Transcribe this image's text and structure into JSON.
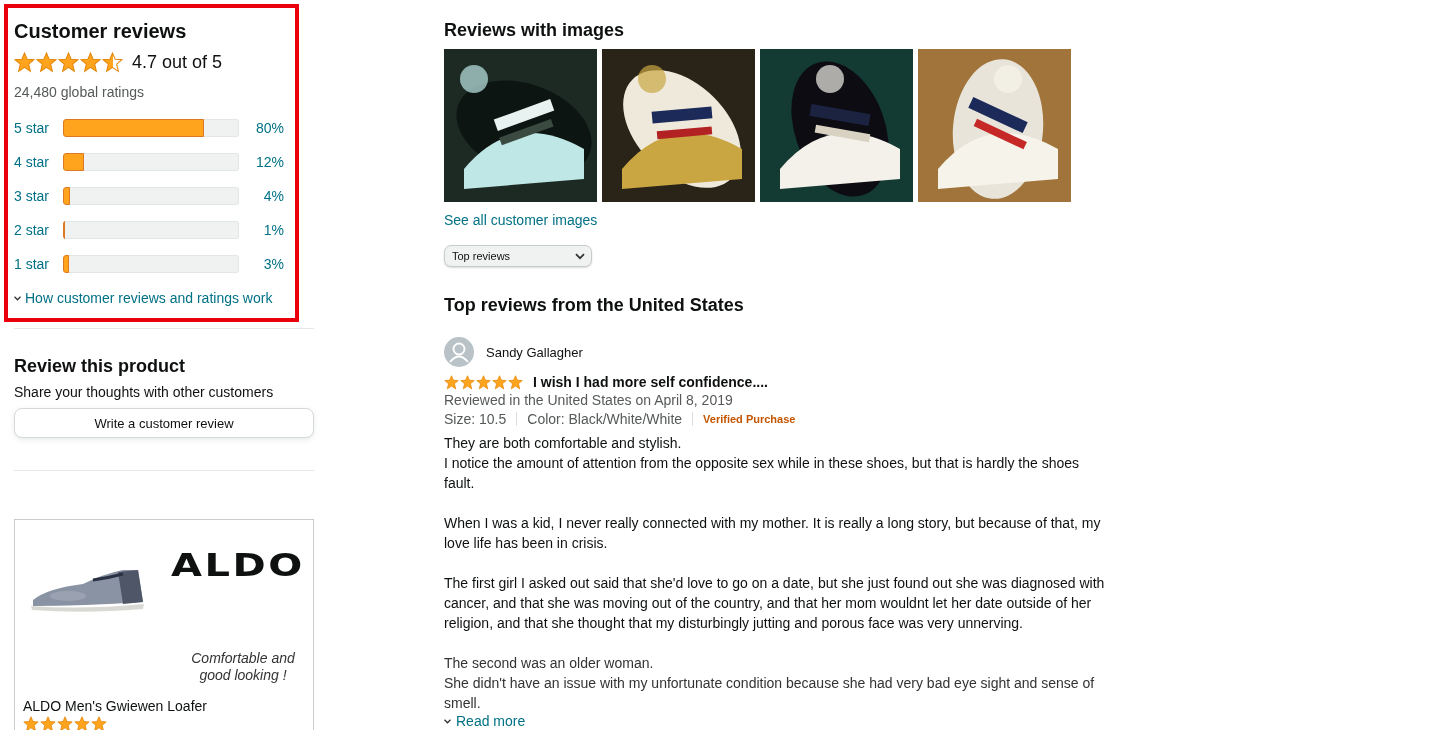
{
  "ratings": {
    "title": "Customer reviews",
    "stars": 4.5,
    "average": "4.7 out of 5",
    "total": "24,480 global ratings",
    "histogram": [
      {
        "label": "5 star",
        "level": 0.8,
        "percent": "80%"
      },
      {
        "label": "4 star",
        "level": 0.12,
        "percent": "12%"
      },
      {
        "label": "3 star",
        "level": 0.04,
        "percent": "4%"
      },
      {
        "label": "2 star",
        "level": 0.01,
        "percent": "1%"
      },
      {
        "label": "1 star",
        "level": 0.03,
        "percent": "3%"
      }
    ],
    "help_link": "How customer reviews and ratings work"
  },
  "review_this_product": {
    "title": "Review this product",
    "subtitle": "Share your thoughts with other customers",
    "button": "Write a customer review"
  },
  "ad": {
    "brand": "ALDO",
    "tagline": "Comfortable and good looking !",
    "product": "ALDO Men's Gwiewen Loafer",
    "stars": 5
  },
  "reviews_with_images": {
    "title": "Reviews with images",
    "link": "See all customer images"
  },
  "sort": {
    "value": "Top reviews"
  },
  "top_reviews": {
    "title": "Top reviews from the United States",
    "reviews": [
      {
        "author": "Sandy Gallagher",
        "stars": 5,
        "headline": "I wish I had more self confidence....",
        "meta": "Reviewed in the United States on April 8, 2019",
        "size": "Size: 10.5",
        "color_option": "Color: Black/White/White",
        "verified": "Verified Purchase",
        "paragraphs": [
          "They are both comfortable and stylish.\nI notice the amount of attention from the opposite sex while in these shoes, but that is hardly the shoes fault.",
          "When I was a kid, I never really connected with my mother. It is really a long story, but because of that, my love life has been in crisis.",
          "The first girl I asked out said that she'd love to go on a date, but she just found out she was diagnosed with cancer, and that she was moving out of the country, and that her mom wouldnt let her date outside of her religion, and that she thought that my disturbingly jutting and porous face was very unnerving.",
          "The second was an older woman.\nShe didn't have an issue with my unfortunate condition because she had very bad eye sight and sense of smell."
        ],
        "read_more": "Read more"
      }
    ]
  }
}
